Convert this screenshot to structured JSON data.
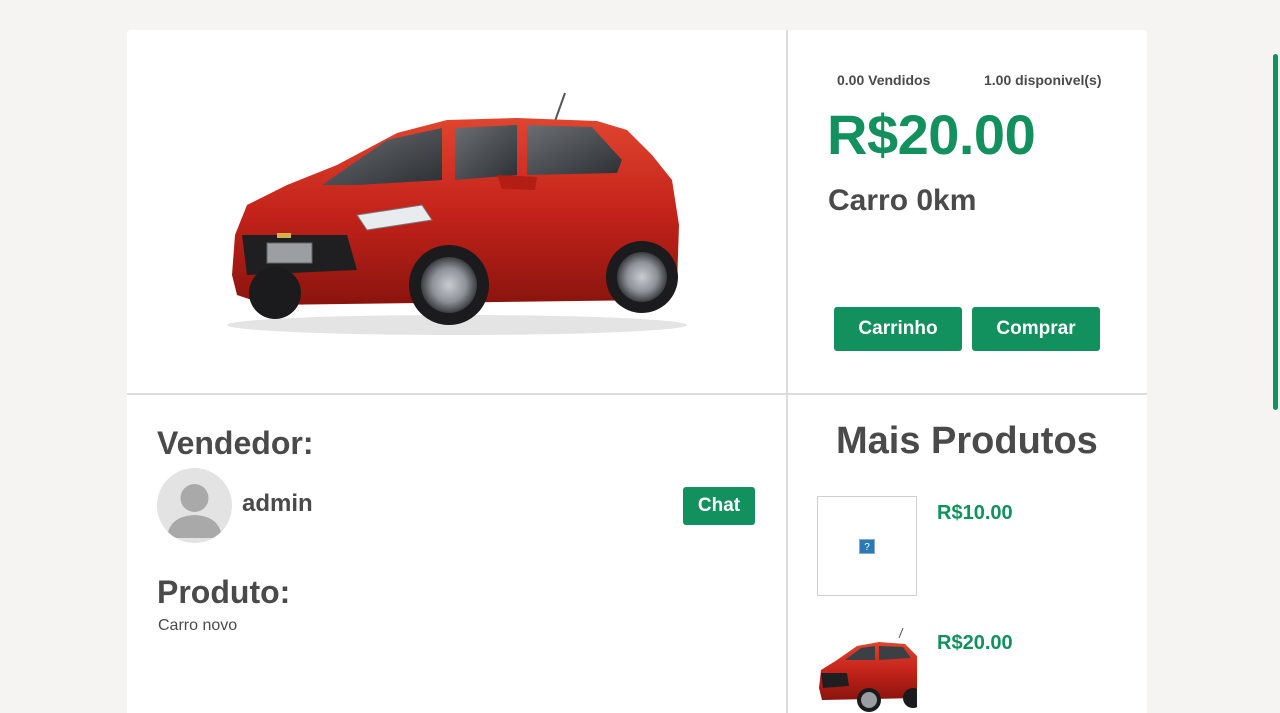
{
  "product": {
    "sold": "0.00 Vendidos",
    "available": "1.00 disponivel(s)",
    "price": "R$20.00",
    "title": "Carro 0km",
    "image_icon": "red-hatchback-car-image"
  },
  "actions": {
    "cart_label": "Carrinho",
    "buy_label": "Comprar"
  },
  "seller": {
    "heading": "Vendedor:",
    "name": "admin",
    "avatar_icon": "user-silhouette-icon",
    "chat_label": "Chat"
  },
  "description": {
    "heading": "Produto:",
    "text": "Carro novo"
  },
  "more_products": {
    "heading": "Mais Produtos",
    "items": [
      {
        "price": "R$10.00",
        "image_icon": "broken-image-icon"
      },
      {
        "price": "R$20.00",
        "image_icon": "red-hatchback-car-image"
      }
    ]
  },
  "colors": {
    "accent": "#12905d",
    "text": "#4a4a4a",
    "background": "#f5f4f2",
    "card": "#ffffff",
    "car_body": "#c8261a"
  }
}
